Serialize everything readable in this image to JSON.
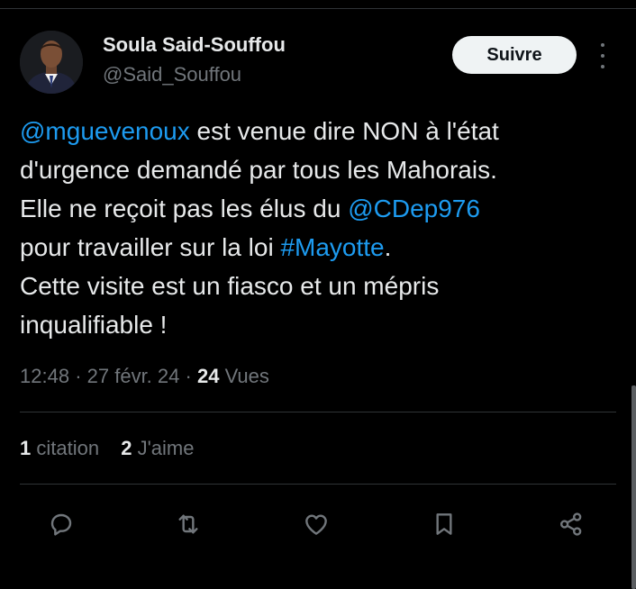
{
  "author": {
    "name": "Soula Said-Souffou",
    "handle": "@Said_Souffou"
  },
  "follow_label": "Suivre",
  "tweet": {
    "lines": [
      [
        {
          "text": "@mguevenoux",
          "link": true
        },
        {
          "text": " est venue dire NON à l'état",
          "link": false
        }
      ],
      [
        {
          "text": "d'urgence demandé par tous les Mahorais.",
          "link": false
        }
      ],
      [
        {
          "text": "Elle ne reçoit pas les élus du ",
          "link": false
        },
        {
          "text": "@CDep976",
          "link": true
        }
      ],
      [
        {
          "text": "pour travailler sur la loi ",
          "link": false
        },
        {
          "text": "#Mayotte",
          "link": true
        },
        {
          "text": ".",
          "link": false
        }
      ],
      [
        {
          "text": "Cette visite est un fiasco et un mépris",
          "link": false
        }
      ],
      [
        {
          "text": "inqualifiable !",
          "link": false
        }
      ]
    ]
  },
  "meta": {
    "time": "12:48",
    "separator": "·",
    "date": "27 févr. 24",
    "views_count": "24",
    "views_label": "Vues"
  },
  "stats": {
    "quotes_count": "1",
    "quotes_label": "citation",
    "likes_count": "2",
    "likes_label": "J'aime"
  },
  "actions": [
    {
      "name": "reply-icon"
    },
    {
      "name": "retweet-icon"
    },
    {
      "name": "like-icon"
    },
    {
      "name": "bookmark-icon"
    },
    {
      "name": "share-icon"
    }
  ],
  "colors": {
    "background": "#000000",
    "text": "#e7e9ea",
    "secondary": "#71767b",
    "link": "#1d9bf0",
    "divider": "#2f3336"
  }
}
